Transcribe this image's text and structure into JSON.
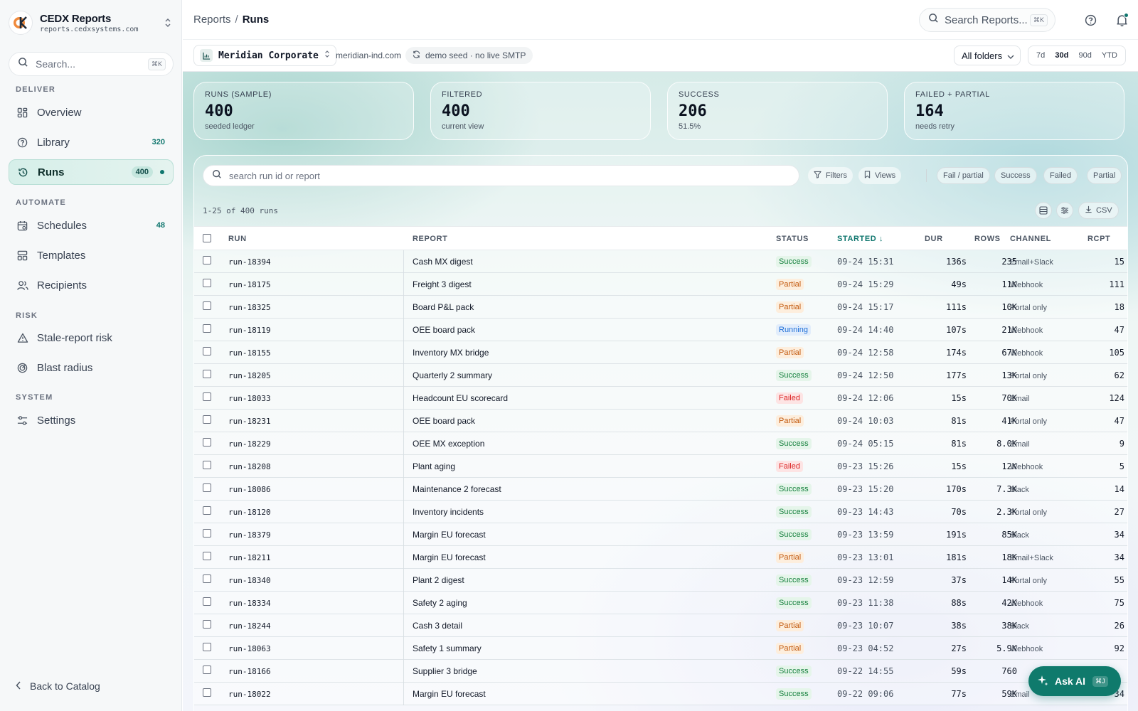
{
  "brand": {
    "name": "CEDX Reports",
    "url": "reports.cedxsystems.com"
  },
  "sidebar": {
    "search_placeholder": "Search...",
    "search_kbd": "⌘K",
    "sections": {
      "deliver": "DELIVER",
      "automate": "AUTOMATE",
      "risk": "RISK",
      "system": "SYSTEM"
    },
    "items": {
      "overview": {
        "label": "Overview"
      },
      "library": {
        "label": "Library",
        "count": "320"
      },
      "runs": {
        "label": "Runs",
        "count": "400"
      },
      "schedules": {
        "label": "Schedules",
        "count": "48"
      },
      "templates": {
        "label": "Templates"
      },
      "recipients": {
        "label": "Recipients"
      },
      "stale": {
        "label": "Stale-report risk"
      },
      "blast": {
        "label": "Blast radius"
      },
      "settings": {
        "label": "Settings"
      }
    },
    "back": "Back to Catalog"
  },
  "header": {
    "breadcrumb_parent": "Reports",
    "breadcrumb_sep": "/",
    "breadcrumb_current": "Runs",
    "search_placeholder": "Search Reports...",
    "search_kbd": "⌘K"
  },
  "context": {
    "org": "Meridian Corporate",
    "domain": "meridian-ind.com",
    "seed": "demo seed · no live SMTP",
    "folders": "All folders",
    "ranges": [
      "7d",
      "30d",
      "90d",
      "YTD"
    ],
    "active_range": "30d"
  },
  "kpis": [
    {
      "label": "RUNS (SAMPLE)",
      "value": "400",
      "sub": "seeded ledger"
    },
    {
      "label": "FILTERED",
      "value": "400",
      "sub": "current view"
    },
    {
      "label": "SUCCESS",
      "value": "206",
      "sub": "51.5%"
    },
    {
      "label": "FAILED + PARTIAL",
      "value": "164",
      "sub": "needs retry"
    }
  ],
  "toolbar": {
    "search_placeholder": "search run id or report",
    "filters": "Filters",
    "views": "Views",
    "chips": [
      "Fail / partial",
      "Success",
      "Failed",
      "Partial"
    ],
    "count_text": "1-25 of 400 runs",
    "csv": "CSV"
  },
  "table": {
    "headers": {
      "run": "RUN",
      "report": "REPORT",
      "status": "STATUS",
      "started": "STARTED",
      "dur": "DUR",
      "rows": "ROWS",
      "channel": "CHANNEL",
      "rcpt": "RCPT"
    },
    "rows": [
      {
        "run": "run-18394",
        "report": "Cash MX digest",
        "status": "Success",
        "started": "09-24 15:31",
        "dur": "136s",
        "rows": "235",
        "channel": "Email+Slack",
        "rcpt": "15"
      },
      {
        "run": "run-18175",
        "report": "Freight 3 digest",
        "status": "Partial",
        "started": "09-24 15:29",
        "dur": "49s",
        "rows": "11K",
        "channel": "Webhook",
        "rcpt": "111"
      },
      {
        "run": "run-18325",
        "report": "Board P&L pack",
        "status": "Partial",
        "started": "09-24 15:17",
        "dur": "111s",
        "rows": "10K",
        "channel": "Portal only",
        "rcpt": "18"
      },
      {
        "run": "run-18119",
        "report": "OEE board pack",
        "status": "Running",
        "started": "09-24 14:40",
        "dur": "107s",
        "rows": "21K",
        "channel": "Webhook",
        "rcpt": "47"
      },
      {
        "run": "run-18155",
        "report": "Inventory MX bridge",
        "status": "Partial",
        "started": "09-24 12:58",
        "dur": "174s",
        "rows": "67K",
        "channel": "Webhook",
        "rcpt": "105"
      },
      {
        "run": "run-18205",
        "report": "Quarterly 2 summary",
        "status": "Success",
        "started": "09-24 12:50",
        "dur": "177s",
        "rows": "13K",
        "channel": "Portal only",
        "rcpt": "62"
      },
      {
        "run": "run-18033",
        "report": "Headcount EU scorecard",
        "status": "Failed",
        "started": "09-24 12:06",
        "dur": "15s",
        "rows": "70K",
        "channel": "Email",
        "rcpt": "124"
      },
      {
        "run": "run-18231",
        "report": "OEE board pack",
        "status": "Partial",
        "started": "09-24 10:03",
        "dur": "81s",
        "rows": "41K",
        "channel": "Portal only",
        "rcpt": "47"
      },
      {
        "run": "run-18229",
        "report": "OEE MX exception",
        "status": "Success",
        "started": "09-24 05:15",
        "dur": "81s",
        "rows": "8.0K",
        "channel": "Email",
        "rcpt": "9"
      },
      {
        "run": "run-18208",
        "report": "Plant aging",
        "status": "Failed",
        "started": "09-23 15:26",
        "dur": "15s",
        "rows": "12K",
        "channel": "Webhook",
        "rcpt": "5"
      },
      {
        "run": "run-18086",
        "report": "Maintenance 2 forecast",
        "status": "Success",
        "started": "09-23 15:20",
        "dur": "170s",
        "rows": "7.3K",
        "channel": "Slack",
        "rcpt": "14"
      },
      {
        "run": "run-18120",
        "report": "Inventory incidents",
        "status": "Success",
        "started": "09-23 14:43",
        "dur": "70s",
        "rows": "2.3K",
        "channel": "Portal only",
        "rcpt": "27"
      },
      {
        "run": "run-18379",
        "report": "Margin EU forecast",
        "status": "Success",
        "started": "09-23 13:59",
        "dur": "191s",
        "rows": "85K",
        "channel": "Slack",
        "rcpt": "34"
      },
      {
        "run": "run-18211",
        "report": "Margin EU forecast",
        "status": "Partial",
        "started": "09-23 13:01",
        "dur": "181s",
        "rows": "18K",
        "channel": "Email+Slack",
        "rcpt": "34"
      },
      {
        "run": "run-18340",
        "report": "Plant 2 digest",
        "status": "Success",
        "started": "09-23 12:59",
        "dur": "37s",
        "rows": "14K",
        "channel": "Portal only",
        "rcpt": "55"
      },
      {
        "run": "run-18334",
        "report": "Safety 2 aging",
        "status": "Success",
        "started": "09-23 11:38",
        "dur": "88s",
        "rows": "42K",
        "channel": "Webhook",
        "rcpt": "75"
      },
      {
        "run": "run-18244",
        "report": "Cash 3 detail",
        "status": "Partial",
        "started": "09-23 10:07",
        "dur": "38s",
        "rows": "38K",
        "channel": "Slack",
        "rcpt": "26"
      },
      {
        "run": "run-18063",
        "report": "Safety 1 summary",
        "status": "Partial",
        "started": "09-23 04:52",
        "dur": "27s",
        "rows": "5.9K",
        "channel": "Webhook",
        "rcpt": "92"
      },
      {
        "run": "run-18166",
        "report": "Supplier 3 bridge",
        "status": "Success",
        "started": "09-22 14:55",
        "dur": "59s",
        "rows": "760",
        "channel": "",
        "rcpt": ""
      },
      {
        "run": "run-18022",
        "report": "Margin EU forecast",
        "status": "Success",
        "started": "09-22 09:06",
        "dur": "77s",
        "rows": "59K",
        "channel": "Email",
        "rcpt": "34"
      }
    ]
  },
  "ask_ai": {
    "label": "Ask AI",
    "kbd": "⌘J"
  },
  "colors": {
    "accent": "#0f766e",
    "success": "#15803d",
    "partial": "#c2580c",
    "failed": "#dc2626",
    "running": "#1d6fd8"
  }
}
